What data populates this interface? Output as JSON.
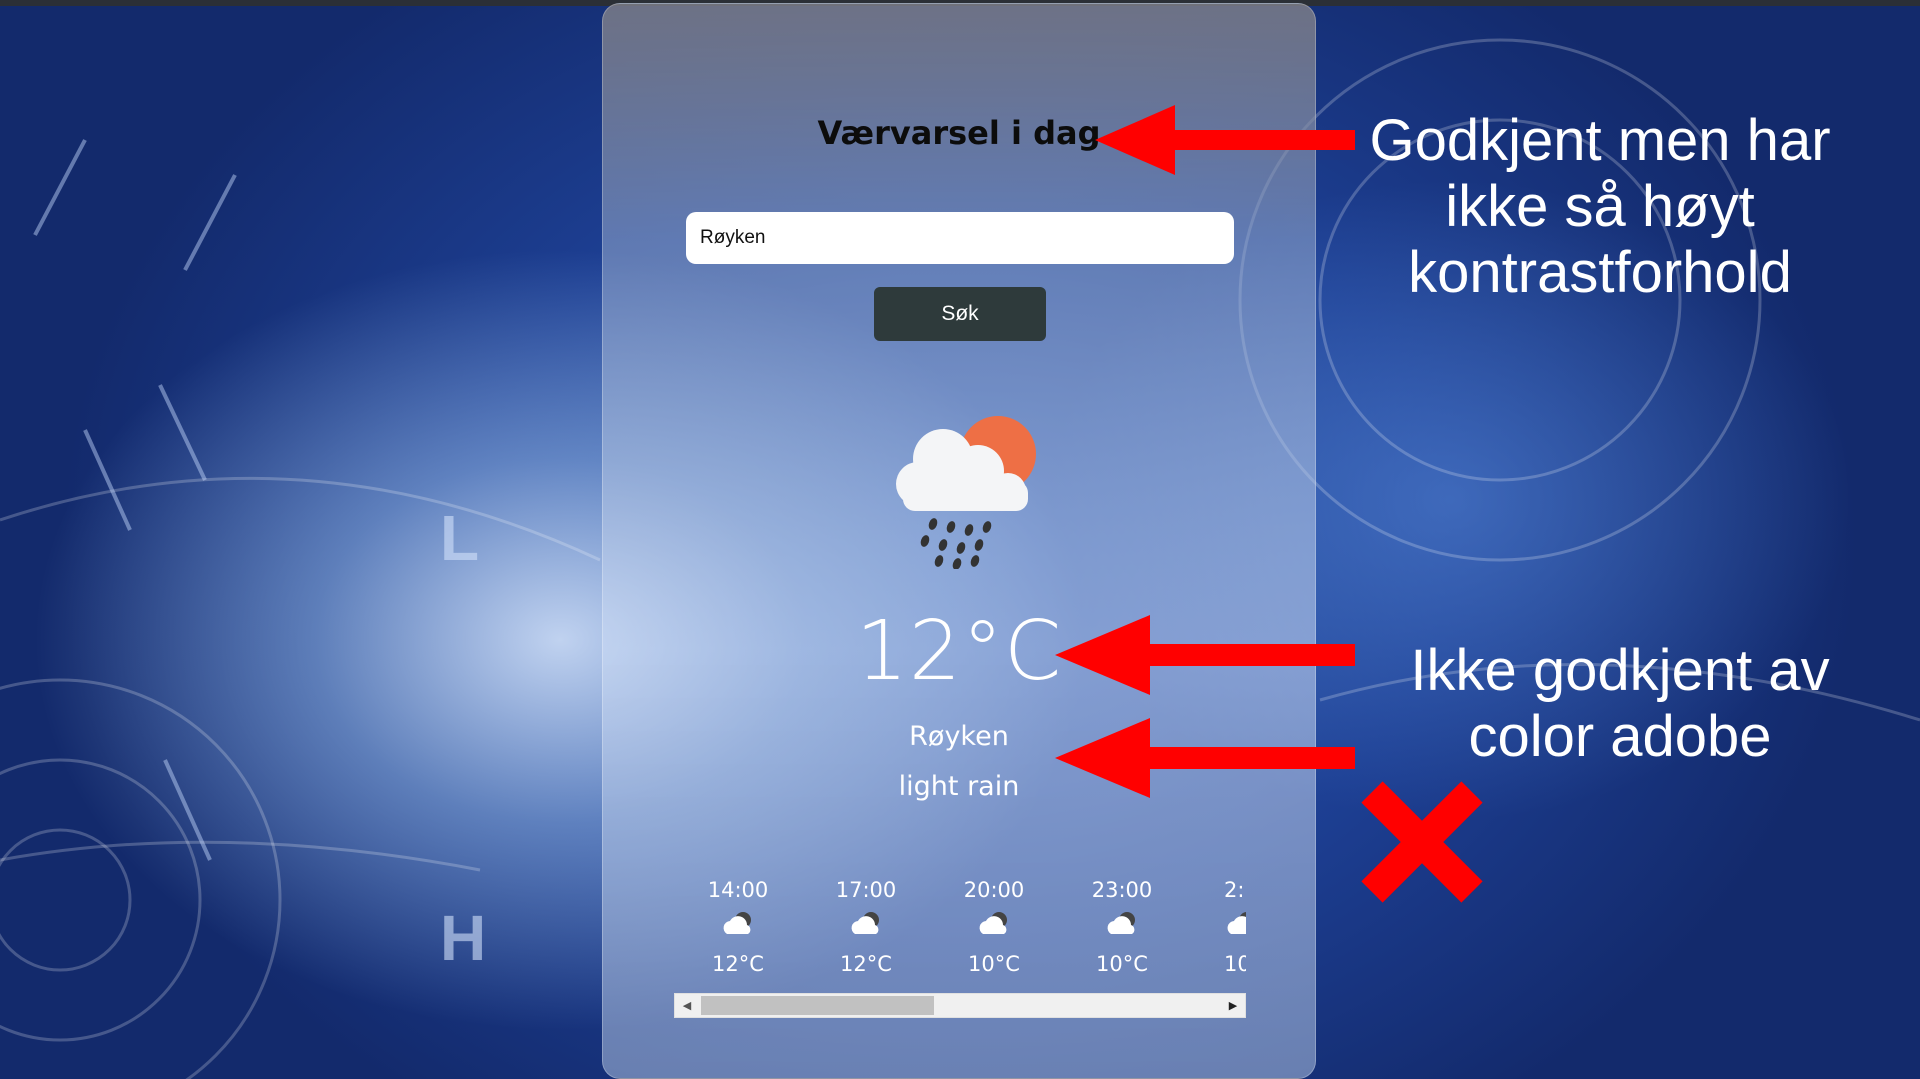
{
  "app": {
    "title": "Værvarsel i dag"
  },
  "search": {
    "value": "Røyken",
    "button_label": "Søk"
  },
  "current": {
    "temperature": "12°C",
    "city": "Røyken",
    "description": "light rain",
    "icon": "cloud-rain-sun-icon"
  },
  "hourly": [
    {
      "time": "14:00",
      "temp": "12°C",
      "icon": "cloud-sun-icon"
    },
    {
      "time": "17:00",
      "temp": "12°C",
      "icon": "cloud-sun-icon"
    },
    {
      "time": "20:00",
      "temp": "10°C",
      "icon": "cloud-sun-icon"
    },
    {
      "time": "23:00",
      "temp": "10°C",
      "icon": "cloud-sun-icon"
    },
    {
      "time": "2:",
      "temp": "10",
      "icon": "cloud-sun-icon"
    }
  ],
  "annotations": {
    "approved": "Godkjent men har ikke så høyt kontrastforhold",
    "not_approved": "Ikke godkjent av color adobe"
  },
  "colors": {
    "arrow": "#ff0000",
    "sun": "#ee6f45",
    "button": "#2e3a3b"
  }
}
